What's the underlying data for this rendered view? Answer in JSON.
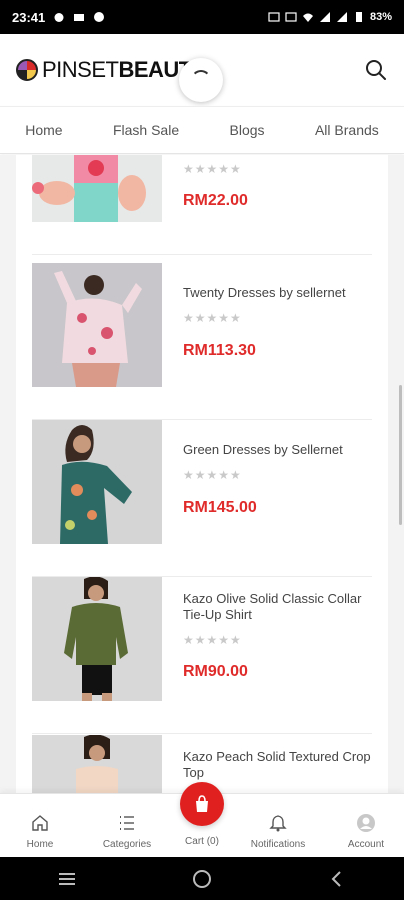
{
  "status_bar": {
    "time": "23:41",
    "battery": "83%"
  },
  "header": {
    "logo_light": "PINSET",
    "logo_bold": "BEAUTY"
  },
  "nav": {
    "items": [
      "Home",
      "Flash Sale",
      "Blogs",
      "All Brands"
    ]
  },
  "products": [
    {
      "name": "",
      "stars": "★★★★★",
      "price": "RM22.00"
    },
    {
      "name": "Twenty Dresses by sellernet",
      "stars": "★★★★★",
      "price": "RM113.30"
    },
    {
      "name": "Green Dresses by Sellernet",
      "stars": "★★★★★",
      "price": "RM145.00"
    },
    {
      "name": "Kazo Olive Solid Classic Collar Tie-Up Shirt",
      "stars": "★★★★★",
      "price": "RM90.00"
    },
    {
      "name": "Kazo Peach Solid Textured Crop Top",
      "stars": "",
      "price": ""
    }
  ],
  "bottom_nav": {
    "home": "Home",
    "categories": "Categories",
    "cart": "Cart (0)",
    "notifications": "Notifications",
    "account": "Account"
  },
  "colors": {
    "accent": "#e0201f",
    "price": "#e02b2b"
  }
}
